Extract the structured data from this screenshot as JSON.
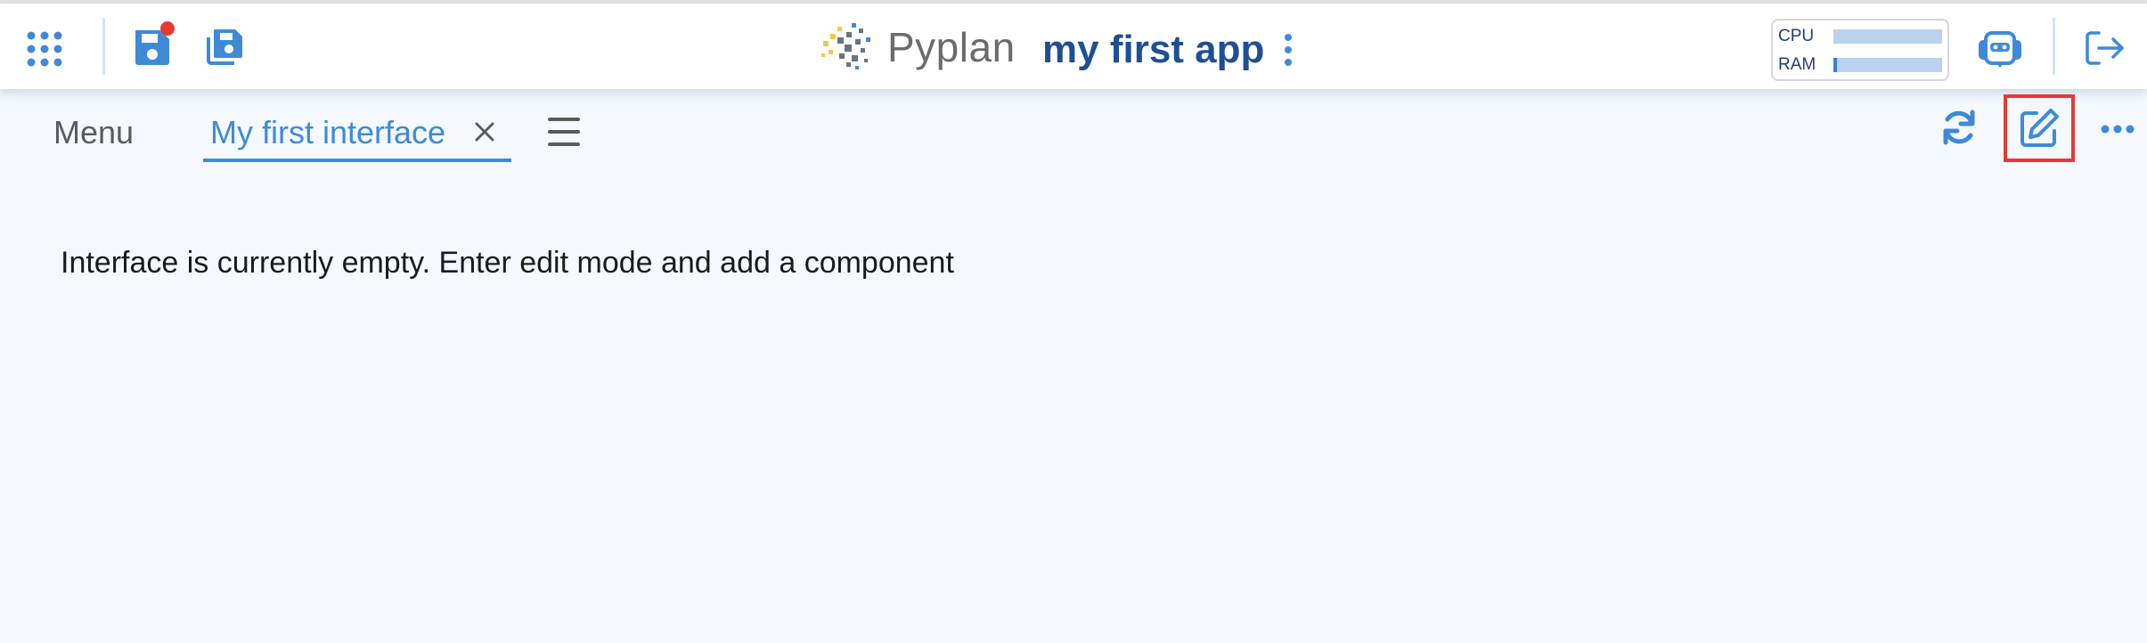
{
  "header": {
    "logo_text": "Pyplan",
    "app_title": "my first app",
    "resources": {
      "cpu_label": "CPU",
      "cpu_usage": 0.0,
      "ram_label": "RAM",
      "ram_usage": 0.03
    },
    "unsaved_indicator_color": "#e53935"
  },
  "tabbar": {
    "menu_label": "Menu",
    "active_tab": {
      "label": "My first interface"
    }
  },
  "main": {
    "empty_message": "Interface is currently empty. Enter edit mode and add a component"
  },
  "colors": {
    "accent": "#3f8ad6",
    "title": "#1f4f91",
    "highlight": "#e53935",
    "background": "#f5f8fd"
  },
  "icons": [
    "apps-grid-icon",
    "save-icon",
    "save-as-icon",
    "kebab-menu-icon",
    "assistant-bot-icon",
    "logout-icon",
    "close-icon",
    "hamburger-menu-icon",
    "refresh-icon",
    "edit-icon",
    "more-horizontal-icon"
  ]
}
